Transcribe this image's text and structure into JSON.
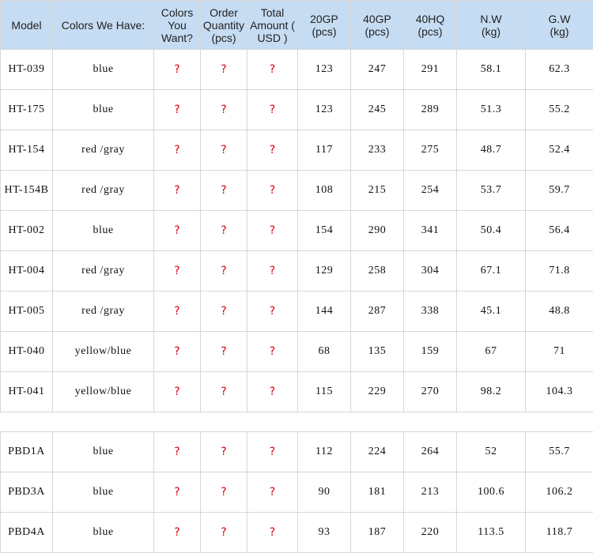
{
  "headers": [
    [
      "Model"
    ],
    [
      "Colors We Have:"
    ],
    [
      "Colors",
      "You",
      "Want?"
    ],
    [
      "Order",
      "Quantity",
      "(pcs)"
    ],
    [
      "Total",
      "Amount (",
      "USD )"
    ],
    [
      "20GP",
      "(pcs)"
    ],
    [
      "40GP",
      "(pcs)"
    ],
    [
      "40HQ",
      "(pcs)"
    ],
    [
      "N.W",
      "(kg)"
    ],
    [
      "G.W",
      "(kg)"
    ]
  ],
  "group1": [
    {
      "model": "HT-039",
      "colors": "blue",
      "want": "?",
      "qty": "?",
      "amount": "?",
      "gp20": "123",
      "gp40": "247",
      "hq40": "291",
      "nw": "58.1",
      "gw": "62.3"
    },
    {
      "model": "HT-175",
      "colors": "blue",
      "want": "?",
      "qty": "?",
      "amount": "?",
      "gp20": "123",
      "gp40": "245",
      "hq40": "289",
      "nw": "51.3",
      "gw": "55.2"
    },
    {
      "model": "HT-154",
      "colors": "red /gray",
      "want": "?",
      "qty": "?",
      "amount": "?",
      "gp20": "117",
      "gp40": "233",
      "hq40": "275",
      "nw": "48.7",
      "gw": "52.4"
    },
    {
      "model": "HT-154B",
      "colors": "red /gray",
      "want": "?",
      "qty": "?",
      "amount": "?",
      "gp20": "108",
      "gp40": "215",
      "hq40": "254",
      "nw": "53.7",
      "gw": "59.7"
    },
    {
      "model": "HT-002",
      "colors": "blue",
      "want": "?",
      "qty": "?",
      "amount": "?",
      "gp20": "154",
      "gp40": "290",
      "hq40": "341",
      "nw": "50.4",
      "gw": "56.4"
    },
    {
      "model": "HT-004",
      "colors": "red /gray",
      "want": "?",
      "qty": "?",
      "amount": "?",
      "gp20": "129",
      "gp40": "258",
      "hq40": "304",
      "nw": "67.1",
      "gw": "71.8"
    },
    {
      "model": "HT-005",
      "colors": "red /gray",
      "want": "?",
      "qty": "?",
      "amount": "?",
      "gp20": "144",
      "gp40": "287",
      "hq40": "338",
      "nw": "45.1",
      "gw": "48.8"
    },
    {
      "model": "HT-040",
      "colors": "yellow/blue",
      "want": "?",
      "qty": "?",
      "amount": "?",
      "gp20": "68",
      "gp40": "135",
      "hq40": "159",
      "nw": "67",
      "gw": "71"
    },
    {
      "model": "HT-041",
      "colors": "yellow/blue",
      "want": "?",
      "qty": "?",
      "amount": "?",
      "gp20": "115",
      "gp40": "229",
      "hq40": "270",
      "nw": "98.2",
      "gw": "104.3"
    }
  ],
  "group2": [
    {
      "model": "PBD1A",
      "colors": "blue",
      "want": "?",
      "qty": "?",
      "amount": "?",
      "gp20": "112",
      "gp40": "224",
      "hq40": "264",
      "nw": "52",
      "gw": "55.7"
    },
    {
      "model": "PBD3A",
      "colors": "blue",
      "want": "?",
      "qty": "?",
      "amount": "?",
      "gp20": "90",
      "gp40": "181",
      "hq40": "213",
      "nw": "100.6",
      "gw": "106.2"
    },
    {
      "model": "PBD4A",
      "colors": "blue",
      "want": "?",
      "qty": "?",
      "amount": "?",
      "gp20": "93",
      "gp40": "187",
      "hq40": "220",
      "nw": "113.5",
      "gw": "118.7"
    }
  ],
  "colors": {
    "header_bg": "#c6dcf2",
    "question_mark": "#d9000d",
    "grid_line": "#d7d7d7"
  }
}
